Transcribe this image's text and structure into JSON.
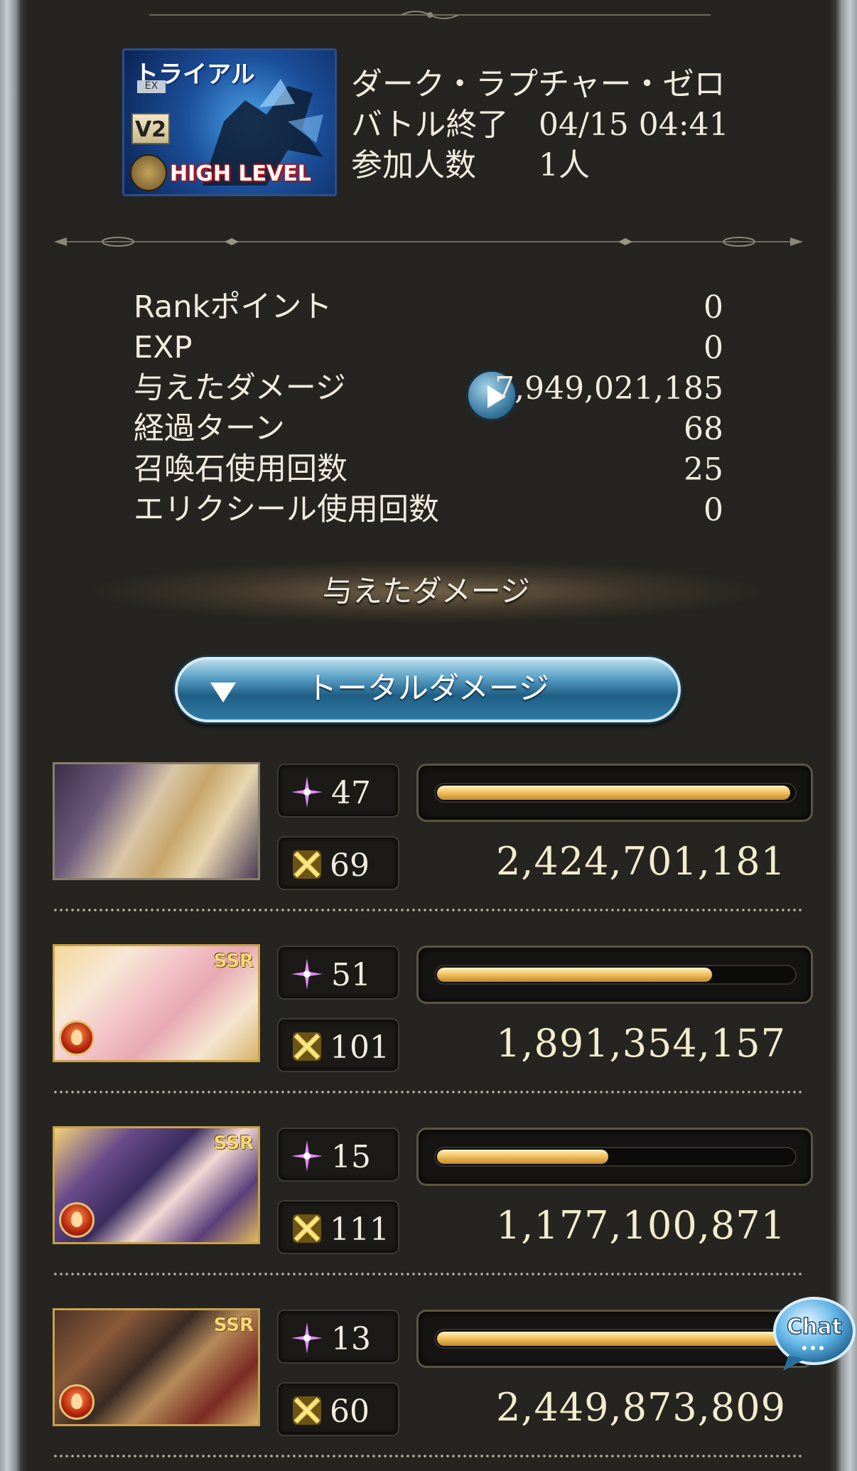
{
  "quest": {
    "banner_trial": "トライアル",
    "banner_ex": "EX",
    "banner_v2": "V2",
    "banner_level": "HIGH LEVEL",
    "name": "ダーク・ラプチャー・ゼロ",
    "end_label": "バトル終了",
    "end_value": "04/15 04:41",
    "participants_label": "参加人数",
    "participants_value": "1人"
  },
  "stats": [
    {
      "label": "Rankポイント",
      "value": "0"
    },
    {
      "label": "EXP",
      "value": "0"
    },
    {
      "label": "与えたダメージ",
      "value": "7,949,021,185"
    },
    {
      "label": "経過ターン",
      "value": "68"
    },
    {
      "label": "召喚石使用回数",
      "value": "25"
    },
    {
      "label": "エリクシール使用回数",
      "value": "0"
    }
  ],
  "section_title": "与えたダメージ",
  "dropdown_label": "トータルダメージ",
  "characters": [
    {
      "ssr": "",
      "skill_count": "47",
      "ougi_count": "69",
      "damage": "2,424,701,181",
      "bar_fraction": 0.99
    },
    {
      "ssr": "SSR",
      "skill_count": "51",
      "ougi_count": "101",
      "damage": "1,891,354,157",
      "bar_fraction": 0.77
    },
    {
      "ssr": "SSR",
      "skill_count": "15",
      "ougi_count": "111",
      "damage": "1,177,100,871",
      "bar_fraction": 0.48
    },
    {
      "ssr": "SSR",
      "skill_count": "13",
      "ougi_count": "60",
      "damage": "2,449,873,809",
      "bar_fraction": 1.0
    }
  ],
  "chat_label": "Chat",
  "icons": {
    "skill": "purple-sparkle-icon",
    "ougi": "gold-crossed-swords-icon",
    "element": "fire-element-icon",
    "play": "play-icon",
    "dropdown": "triangle-down-icon"
  },
  "colors": {
    "background": "#252420",
    "bar_gold": "#f4c462",
    "dropdown_blue": "#2f7aa3",
    "banner_red": "#c21010"
  }
}
